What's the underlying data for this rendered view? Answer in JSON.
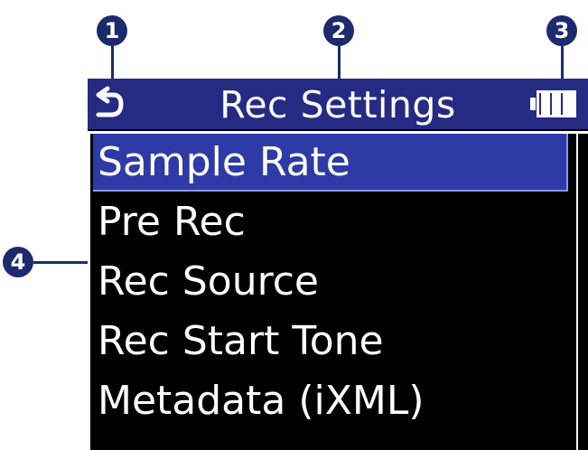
{
  "callouts": [
    "1",
    "2",
    "3",
    "4"
  ],
  "header": {
    "back_icon": "back-arrow-icon",
    "title": "Rec Settings",
    "battery_icon": "battery-full-icon"
  },
  "menu": {
    "items": [
      {
        "label": "Sample Rate",
        "selected": true
      },
      {
        "label": "Pre Rec",
        "selected": false
      },
      {
        "label": "Rec Source",
        "selected": false
      },
      {
        "label": "Rec Start Tone",
        "selected": false
      },
      {
        "label": "Metadata (iXML)",
        "selected": false
      }
    ]
  },
  "colors": {
    "header_bg": "#252a82",
    "selection_bg": "#2e3ba6",
    "callout": "#1d2a6e",
    "screen_bg": "#000000"
  }
}
